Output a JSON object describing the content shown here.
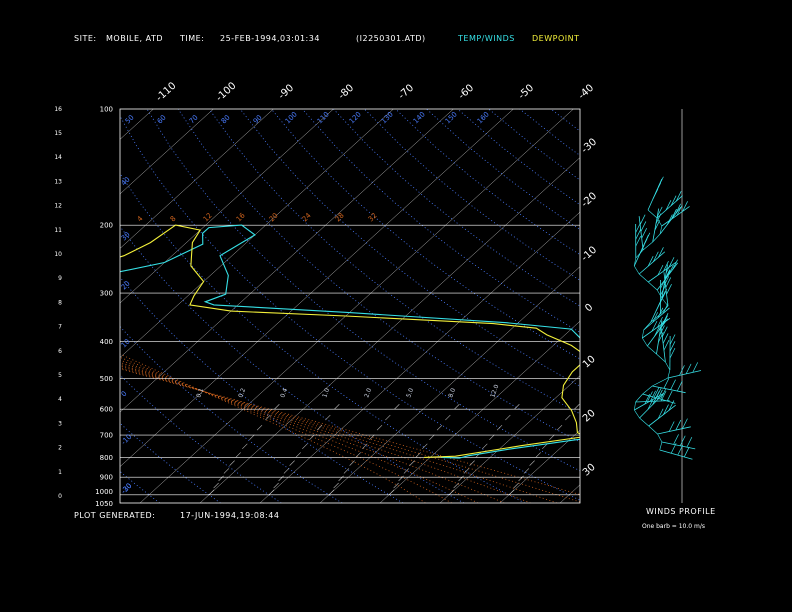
{
  "header": {
    "site_label": "SITE:",
    "site_value": "MOBILE, ATD",
    "time_label": "TIME:",
    "time_value": "25-FEB-1994,03:01:34",
    "file_name": "(I2250301.ATD)",
    "temp_legend": "TEMP/WINDS",
    "dew_legend": "DEWPOINT"
  },
  "footer": {
    "generated_label": "PLOT GENERATED:",
    "generated_value": "17-JUN-1994,19:08:44",
    "winds_title": "WINDS PROFILE",
    "barb_note": "One barb = 10.0 m/s"
  },
  "colors": {
    "background": "#000000",
    "temp": "#36e0e6",
    "dewpoint": "#f3f03a",
    "frame": "#ffffff",
    "isotherm": "#ffffff",
    "dry_adiabat": "#4a7cff",
    "moist_adiabat": "#d0641e",
    "mixing_ratio": "#ffffff"
  },
  "chart_data": {
    "type": "line",
    "title": "",
    "xlabel": "",
    "ylabel": "",
    "pressure_levels": [
      "100",
      "200",
      "300",
      "400",
      "500",
      "600",
      "700",
      "800",
      "900",
      "1000",
      "1050"
    ],
    "height_ticks": [
      "0",
      "1",
      "2",
      "3",
      "4",
      "5",
      "6",
      "7",
      "8",
      "9",
      "10",
      "11",
      "12",
      "13",
      "14",
      "15",
      "16"
    ],
    "top_isotherm_labels": [
      "-110",
      "-100",
      "-90",
      "-80",
      "-70",
      "-60",
      "-50",
      "-40"
    ],
    "right_isotherm_labels": [
      "-30",
      "-20",
      "-10",
      "0",
      "10",
      "20",
      "30"
    ],
    "dry_adiabat_top_labels": [
      "50",
      "60",
      "70",
      "80",
      "90",
      "100",
      "110",
      "120",
      "130",
      "140",
      "150",
      "160"
    ],
    "dry_adiabat_left_labels": [
      "40",
      "30",
      "20",
      "10",
      "0",
      "-10",
      "-20",
      "-30"
    ],
    "moist_adiabat_labels": [
      "4",
      "8",
      "12",
      "16",
      "20",
      "24",
      "28",
      "32"
    ],
    "mixing_ratio_labels": [
      "0.1",
      "0.2",
      "0.4",
      "1.0",
      "2.0",
      "5.0",
      "8.0",
      "12.0"
    ],
    "series": [
      {
        "name": "TEMP/WINDS",
        "points": [
          [
            2.0,
            800
          ],
          [
            5.0,
            803
          ],
          [
            6.0,
            792
          ],
          [
            12.0,
            760
          ],
          [
            21.0,
            720
          ],
          [
            25.0,
            706
          ],
          [
            26.0,
            690
          ],
          [
            24.0,
            660
          ],
          [
            22.0,
            620
          ],
          [
            18.0,
            570
          ],
          [
            13.0,
            522
          ],
          [
            12.0,
            480
          ],
          [
            10.0,
            450
          ],
          [
            6.0,
            412
          ],
          [
            0.0,
            372
          ],
          [
            -12.0,
            358
          ],
          [
            -40.0,
            337
          ],
          [
            -64.0,
            322
          ],
          [
            -66.0,
            316
          ],
          [
            -64.0,
            302
          ],
          [
            -67.0,
            270
          ],
          [
            -72.0,
            240
          ],
          [
            -70.0,
            212
          ],
          [
            -74.0,
            200
          ],
          [
            -79.0,
            203
          ],
          [
            -79.0,
            210
          ],
          [
            -77.0,
            224
          ],
          [
            -80.0,
            250
          ],
          [
            -88.0,
            270
          ],
          [
            -94.0,
            295
          ],
          [
            -99.0,
            318
          ],
          [
            -99.0,
            326
          ]
        ]
      },
      {
        "name": "DEWPOINT",
        "points": [
          [
            -1.0,
            800
          ],
          [
            4.0,
            794
          ],
          [
            13.0,
            746
          ],
          [
            22.0,
            706
          ],
          [
            20.0,
            690
          ],
          [
            18.0,
            650
          ],
          [
            15.0,
            605
          ],
          [
            11.0,
            560
          ],
          [
            9.0,
            520
          ],
          [
            8.0,
            480
          ],
          [
            8.0,
            440
          ],
          [
            3.0,
            410
          ],
          [
            -3.0,
            385
          ],
          [
            -6.0,
            370
          ],
          [
            -14.0,
            360
          ],
          [
            -40.0,
            344
          ],
          [
            -60.0,
            334
          ],
          [
            -68.0,
            322
          ],
          [
            -69.0,
            305
          ],
          [
            -70.0,
            280
          ],
          [
            -75.0,
            255
          ],
          [
            -77.0,
            238
          ],
          [
            -79.0,
            222
          ],
          [
            -80.0,
            206
          ],
          [
            -85.0,
            200
          ],
          [
            -86.0,
            222
          ],
          [
            -88.0,
            240
          ],
          [
            -94.0,
            265
          ],
          [
            -100.0,
            292
          ],
          [
            -101.0,
            318
          ],
          [
            -101.0,
            326
          ]
        ]
      }
    ]
  }
}
